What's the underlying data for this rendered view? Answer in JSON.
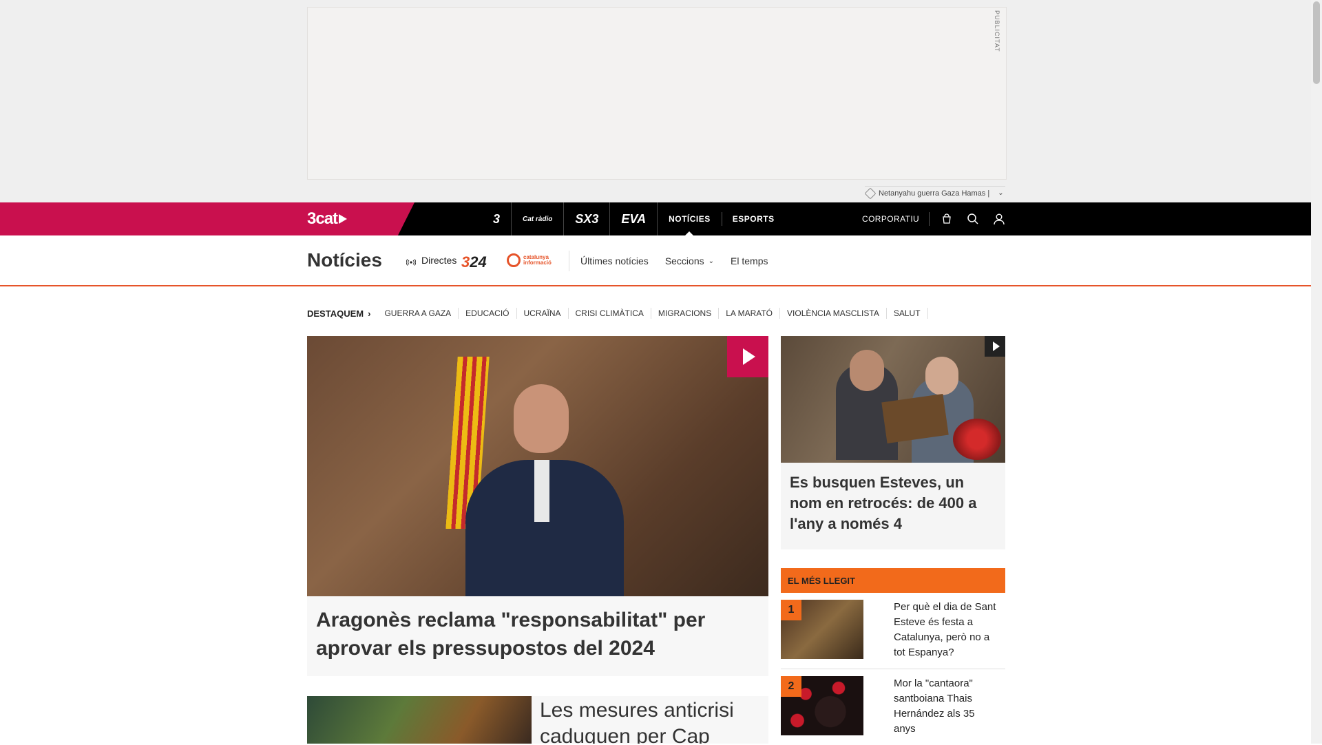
{
  "ad": {
    "label": "PUBLICITAT",
    "tag_text": "Netanyahu guerra Gaza Hamas |"
  },
  "topbar": {
    "brand": "3cat",
    "channels": [
      {
        "label": "3",
        "kind": "logo"
      },
      {
        "label": "Cat ràdio",
        "kind": "logo"
      },
      {
        "label": "SX3",
        "kind": "logo"
      },
      {
        "label": "EVA",
        "kind": "logo"
      },
      {
        "label": "NOTÍCIES",
        "kind": "text"
      },
      {
        "label": "ESPORTS",
        "kind": "text"
      }
    ],
    "corporate": "CORPORATIU"
  },
  "section": {
    "title": "Notícies",
    "directes": "Directes",
    "logo324": "324",
    "logo_ci": "catalunya informació",
    "nav": [
      "Últimes notícies",
      "Seccions",
      "El temps"
    ]
  },
  "topics": {
    "lead": "DESTAQUEM",
    "items": [
      "GUERRA A GAZA",
      "EDUCACIÓ",
      "UCRAÏNA",
      "CRISI CLIMÀTICA",
      "MIGRACIONS",
      "LA MARATÓ",
      "VIOLÈNCIA MASCLISTA",
      "SALUT"
    ]
  },
  "main_article": {
    "title": "Aragonès reclama \"responsabilitat\" per aprovar els pressupostos del 2024"
  },
  "side_article": {
    "title": "Es busquen Esteves, un nom en retrocés: de 400 a l'any a només 4"
  },
  "most_read": {
    "heading": "EL MÉS LLEGIT",
    "items": [
      {
        "rank": "1",
        "title": "Per què el dia de Sant Esteve és festa a Catalunya, però no a tot Espanya?"
      },
      {
        "rank": "2",
        "title": "Mor la \"cantaora\" santboiana Thais Hernández als 35 anys"
      }
    ]
  },
  "second_article": {
    "title": "Les mesures anticrisi caduquen per Cap"
  }
}
